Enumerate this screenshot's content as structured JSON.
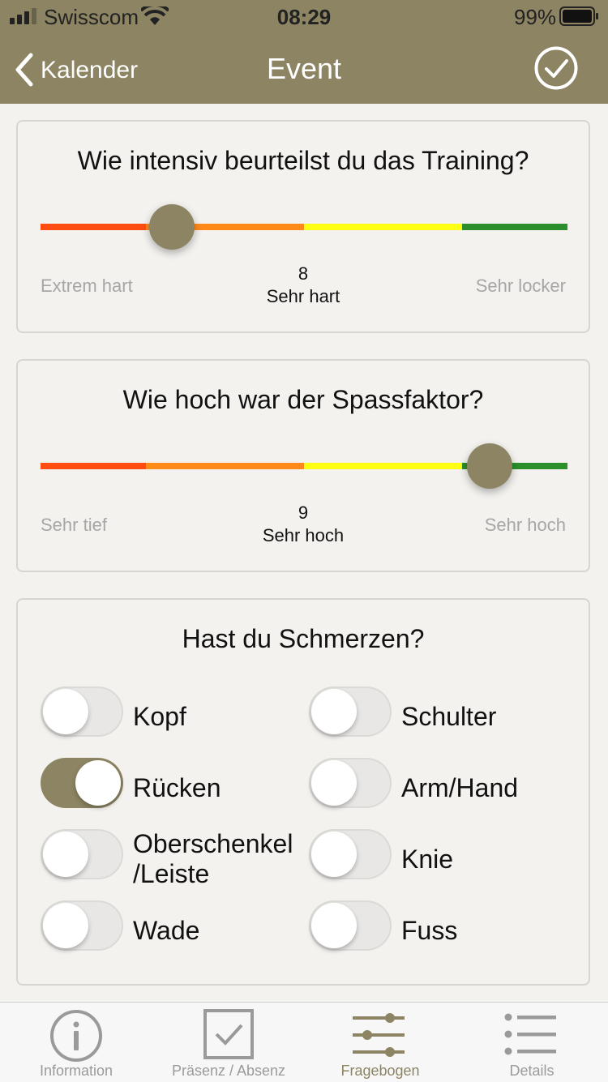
{
  "status_bar": {
    "carrier": "Swisscom",
    "time": "08:29",
    "battery": "99%"
  },
  "nav": {
    "back_label": "Kalender",
    "title": "Event"
  },
  "colors": {
    "accent": "#8c8462",
    "track_red": "#ff4d12",
    "track_orange": "#ff8a1a",
    "track_yellow": "#ffff14",
    "track_green": "#2b8f2b"
  },
  "sliders": [
    {
      "question": "Wie intensiv beurteilst du das Training?",
      "min_label": "Extrem hart",
      "max_label": "Sehr locker",
      "value": "8",
      "value_label": "Sehr hart"
    },
    {
      "question": "Wie hoch war der Spassfaktor?",
      "min_label": "Sehr tief",
      "max_label": "Sehr hoch",
      "value": "9",
      "value_label": "Sehr hoch"
    }
  ],
  "pain": {
    "question": "Hast du Schmerzen?",
    "items": [
      {
        "label": "Kopf",
        "on": false
      },
      {
        "label": "Schulter",
        "on": false
      },
      {
        "label": "Rücken",
        "on": true
      },
      {
        "label": "Arm/Hand",
        "on": false
      },
      {
        "label": "Oberschenkel\n/Leiste",
        "on": false
      },
      {
        "label": "Knie",
        "on": false
      },
      {
        "label": "Wade",
        "on": false
      },
      {
        "label": "Fuss",
        "on": false
      }
    ]
  },
  "tabs": [
    {
      "label": "Information",
      "icon": "info-icon",
      "active": false
    },
    {
      "label": "Präsenz / Absenz",
      "icon": "checkbox-icon",
      "active": false
    },
    {
      "label": "Fragebogen",
      "icon": "sliders-icon",
      "active": true
    },
    {
      "label": "Details",
      "icon": "list-icon",
      "active": false
    }
  ]
}
